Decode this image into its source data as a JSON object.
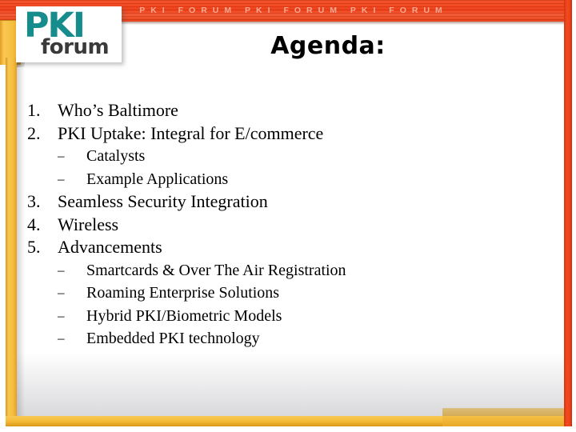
{
  "banner": {
    "repeat_text": "PKI  FORUM   PKI  FORUM   PKI  FORUM",
    "color": "#EE3A12",
    "text_color": "#F9A98F"
  },
  "logo": {
    "primary": "PKI",
    "secondary": "forum",
    "primary_color": "#178C8C",
    "secondary_color": "#3A3A3A"
  },
  "frame": {
    "gold_color": "#F5BE41",
    "red_color": "#EF4119"
  },
  "slide": {
    "title": "Agenda:",
    "items": [
      {
        "number": "1.",
        "text": "Who’s Baltimore",
        "subitems": []
      },
      {
        "number": "2.",
        "text": "PKI Uptake: Integral for E/commerce",
        "subitems": [
          {
            "dash": "–",
            "text": "Catalysts"
          },
          {
            "dash": "–",
            "text": "Example Applications"
          }
        ]
      },
      {
        "number": "3.",
        "text": "Seamless Security Integration",
        "subitems": []
      },
      {
        "number": "4.",
        "text": "Wireless",
        "subitems": []
      },
      {
        "number": "5.",
        "text": "Advancements",
        "subitems": [
          {
            "dash": "–",
            "text": "Smartcards & Over The Air Registration"
          },
          {
            "dash": "–",
            "text": "Roaming Enterprise Solutions"
          },
          {
            "dash": "–",
            "text": "Hybrid PKI/Biometric Models"
          },
          {
            "dash": "–",
            "text": "Embedded PKI technology"
          }
        ]
      }
    ]
  }
}
